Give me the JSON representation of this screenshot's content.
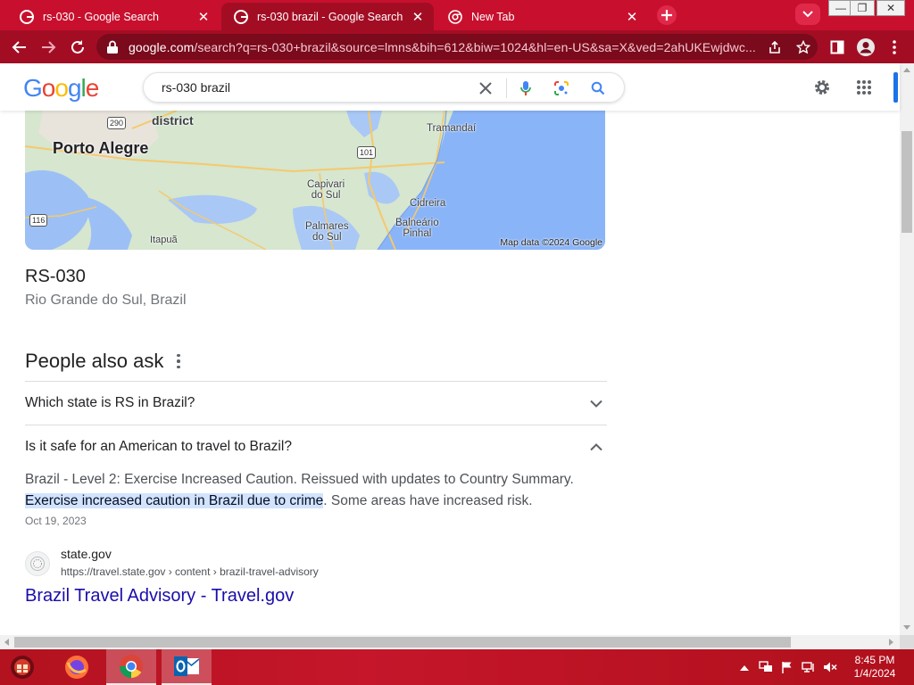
{
  "browser": {
    "tabs": [
      {
        "title": "rs-030 - Google Search",
        "active": false
      },
      {
        "title": "rs-030 brazil - Google Search",
        "active": true
      },
      {
        "title": "New Tab",
        "active": false
      }
    ],
    "address": {
      "domain": "google.com",
      "path": "/search?q=rs-030+brazil&source=lmns&bih=612&biw=1024&hl=en-US&sa=X&ved=2ahUKEwjdwc..."
    },
    "theme_color": "#c8102e"
  },
  "search": {
    "logo": [
      "G",
      "o",
      "o",
      "g",
      "l",
      "e"
    ],
    "query": "rs-030 brazil"
  },
  "map": {
    "labels": {
      "district": "district",
      "porto_alegre": "Porto Alegre",
      "tramandai": "Tramandaí",
      "capivari": "Capivari\ndo Sul",
      "cidreira": "Cidreira",
      "balneario": "Balneário\nPinhal",
      "palmares": "Palmares\ndo Sul",
      "itapua": "Itapuã"
    },
    "shields": {
      "r290": "290",
      "r101": "101",
      "r116": "116"
    },
    "credit": "Map data ©2024 Google"
  },
  "place": {
    "name": "RS-030",
    "region": "Rio Grande do Sul, Brazil"
  },
  "people_also_ask": {
    "title": "People also ask",
    "questions": [
      {
        "text": "Which state is RS in Brazil?",
        "expanded": false
      },
      {
        "text": "Is it safe for an American to travel to Brazil?",
        "expanded": true
      }
    ],
    "answer": {
      "text_start": "Brazil - Level 2: Exercise Increased Caution. Reissued with updates to Country Summary.",
      "highlight": "Exercise increased caution in Brazil due to crime",
      "text_end": ". Some areas have increased risk.",
      "date": "Oct 19, 2023",
      "source_name": "state.gov",
      "source_url": "https://travel.state.gov › content › brazil-travel-advisory",
      "link_title": "Brazil Travel Advisory - Travel.gov"
    }
  },
  "taskbar": {
    "clock_time": "8:45 PM",
    "clock_date": "1/4/2024"
  }
}
